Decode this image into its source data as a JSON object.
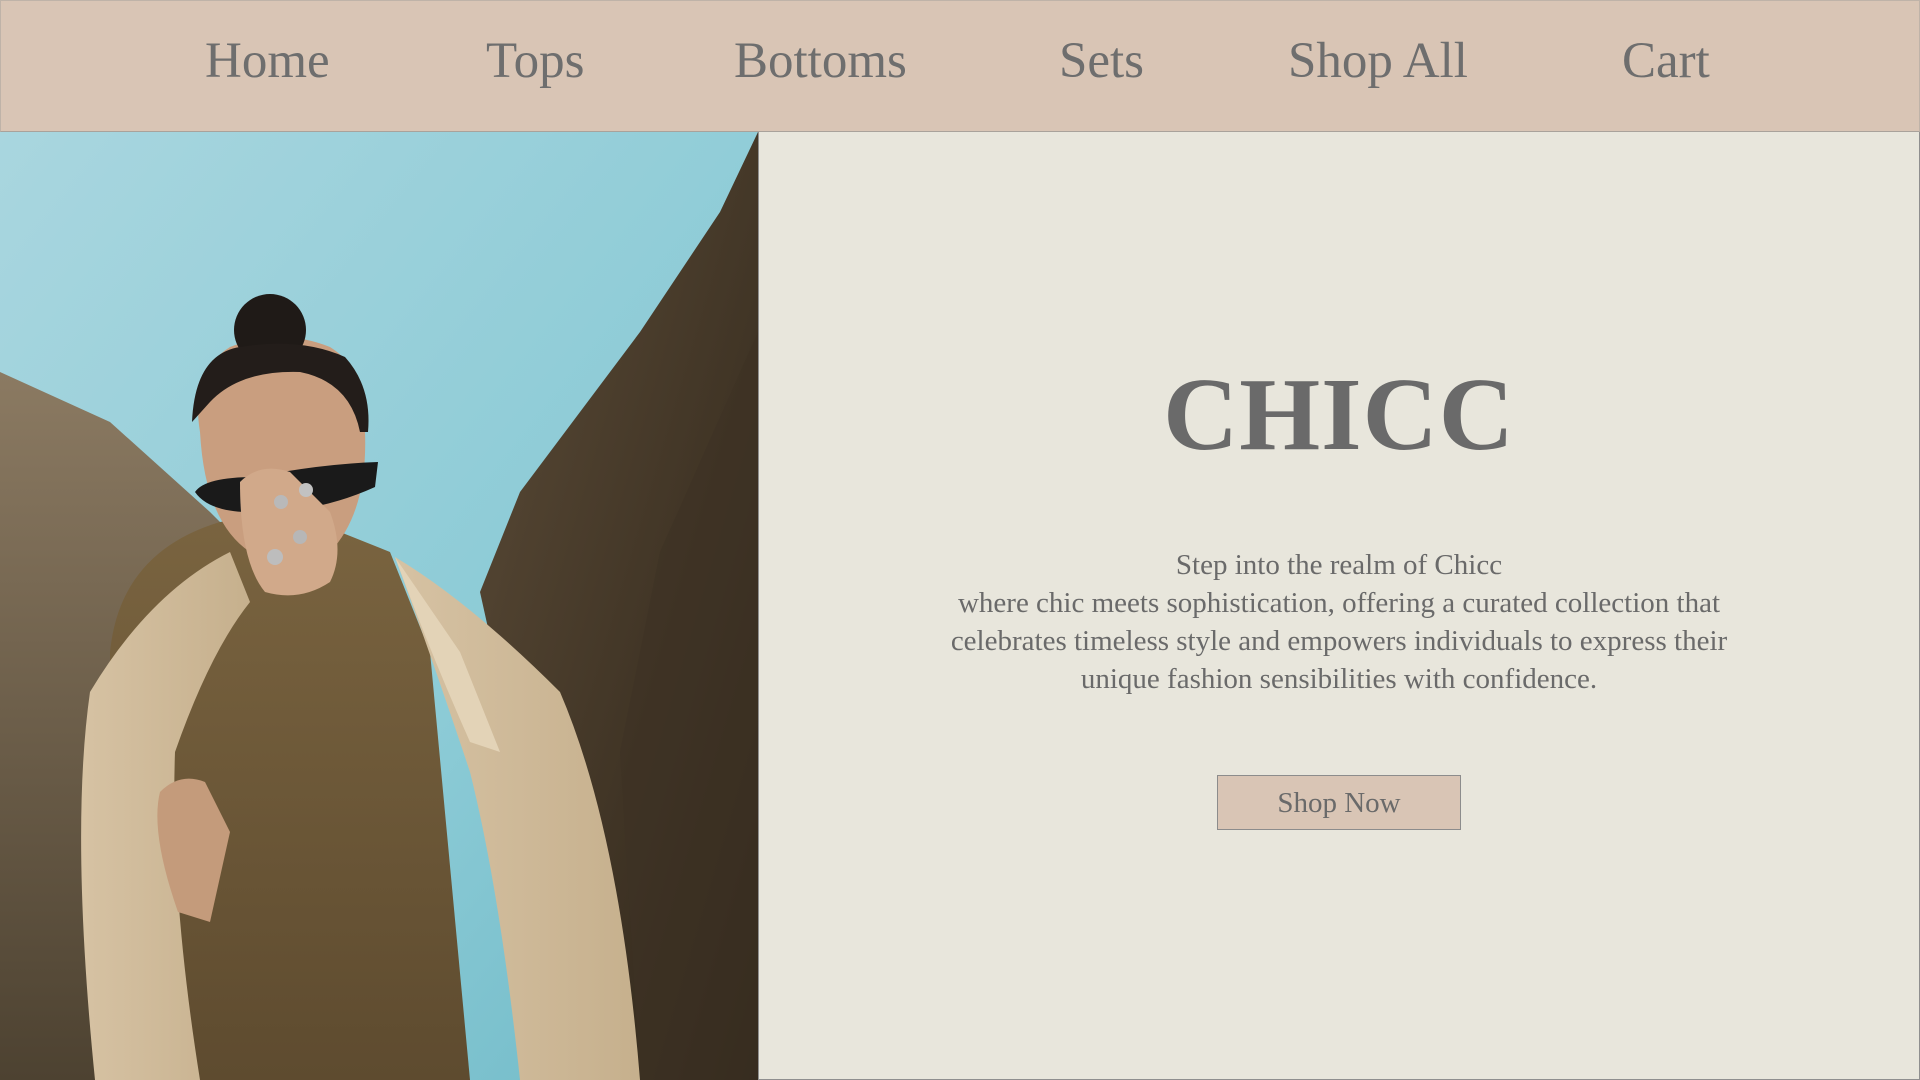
{
  "nav": {
    "items": [
      {
        "label": "Home"
      },
      {
        "label": "Tops"
      },
      {
        "label": "Bottoms"
      },
      {
        "label": "Sets"
      },
      {
        "label": "Shop All"
      },
      {
        "label": "Cart"
      }
    ]
  },
  "hero": {
    "image_description": "woman-in-camel-coat-and-sunglasses",
    "brand": "CHICC",
    "tagline_lines": [
      "Step into the realm of Chicc",
      "where chic meets sophistication, offering a curated collection that",
      "celebrates timeless style and empowers individuals to express their",
      "unique fashion sensibilities with confidence."
    ],
    "cta_label": "Shop Now"
  },
  "colors": {
    "nav_bg": "#d9c5b5",
    "panel_bg": "#e8e6dc",
    "text": "#6a6a6a",
    "button_bg": "#d9c5b5"
  }
}
